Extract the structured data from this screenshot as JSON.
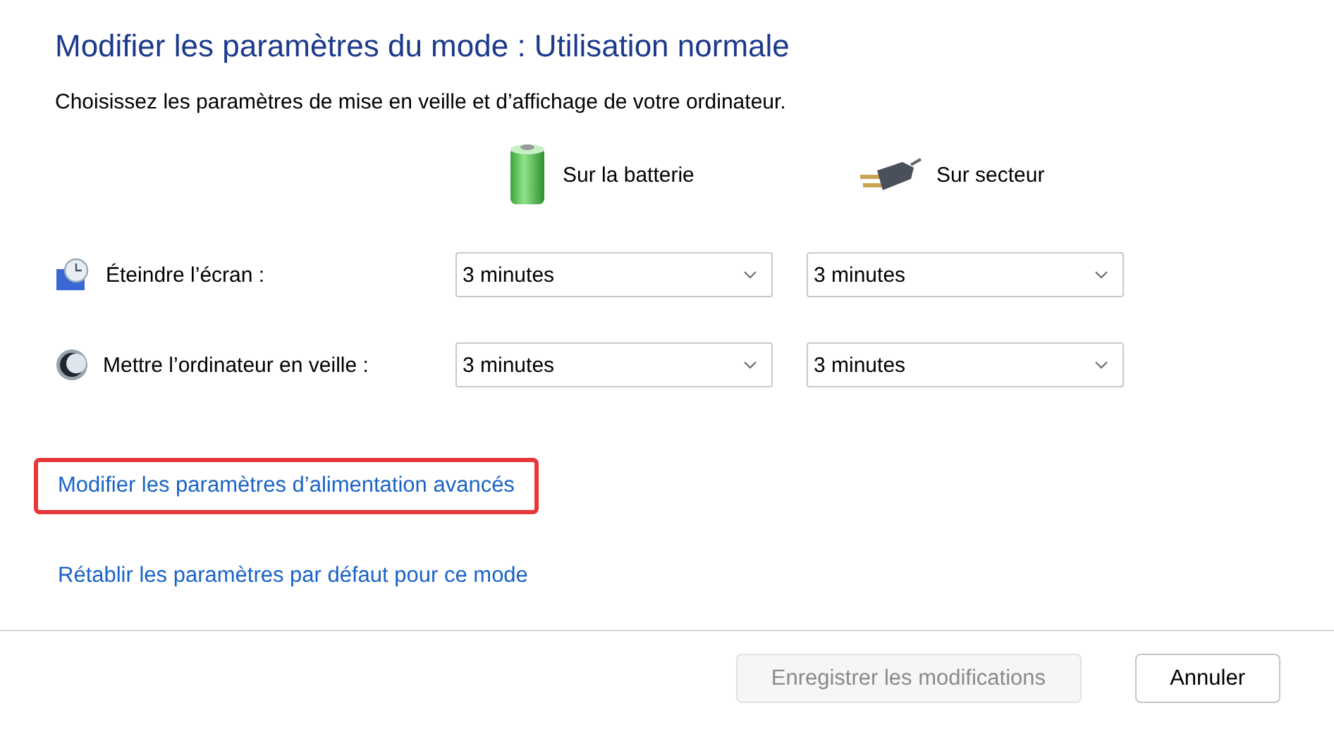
{
  "title": "Modifier les paramètres du mode : Utilisation normale",
  "subtitle": "Choisissez les paramètres de mise en veille et d’affichage de votre ordinateur.",
  "columns": [
    {
      "kind": "battery",
      "label": "Sur la batterie"
    },
    {
      "kind": "plug",
      "label": "Sur secteur"
    }
  ],
  "settings": [
    {
      "kind": "display",
      "label": "Éteindre l’écran :",
      "values": [
        "3 minutes",
        "3 minutes"
      ]
    },
    {
      "kind": "sleep",
      "label": "Mettre l’ordinateur en veille :",
      "values": [
        "3 minutes",
        "3 minutes"
      ]
    }
  ],
  "links": [
    {
      "label": "Modifier les paramètres d’alimentation avancés",
      "highlighted": true
    },
    {
      "label": "Rétablir les paramètres par défaut pour ce mode",
      "highlighted": false
    }
  ],
  "buttons": [
    {
      "label": "Enregistrer les modifications",
      "disabled": true
    },
    {
      "label": "Annuler",
      "disabled": false
    }
  ]
}
